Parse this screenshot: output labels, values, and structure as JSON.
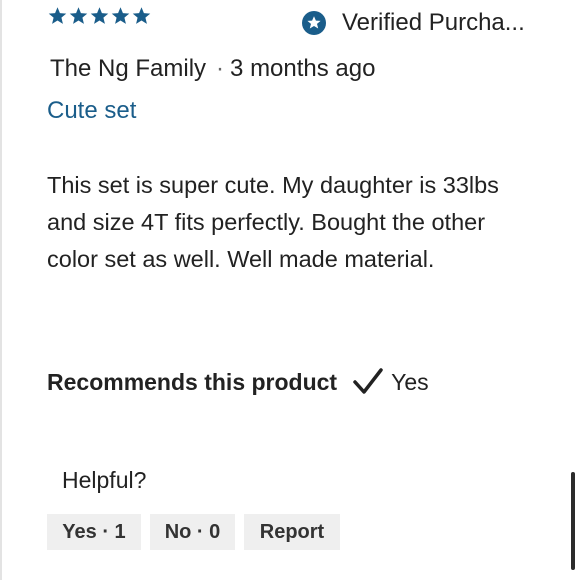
{
  "review": {
    "rating": 5,
    "rating_max": 5,
    "star_color": "#1a5d8a",
    "verified_label": "Verified Purcha...",
    "author": "The Ng Family",
    "separator": "·",
    "date": "3 months ago",
    "title": "Cute set",
    "body": "This set is super cute. My daughter is 33lbs and size 4T fits perfectly. Bought the other color set as well. Well made material.",
    "recommends_label": "Recommends this product",
    "recommends_icon": "checkmark-icon",
    "recommends_value": "Yes"
  },
  "feedback": {
    "helpful_label": "Helpful?",
    "yes_label": "Yes · 1",
    "no_label": "No · 0",
    "report_label": "Report"
  },
  "colors": {
    "accent": "#1a5d8a",
    "button_bg": "#efefef",
    "text": "#222222"
  }
}
